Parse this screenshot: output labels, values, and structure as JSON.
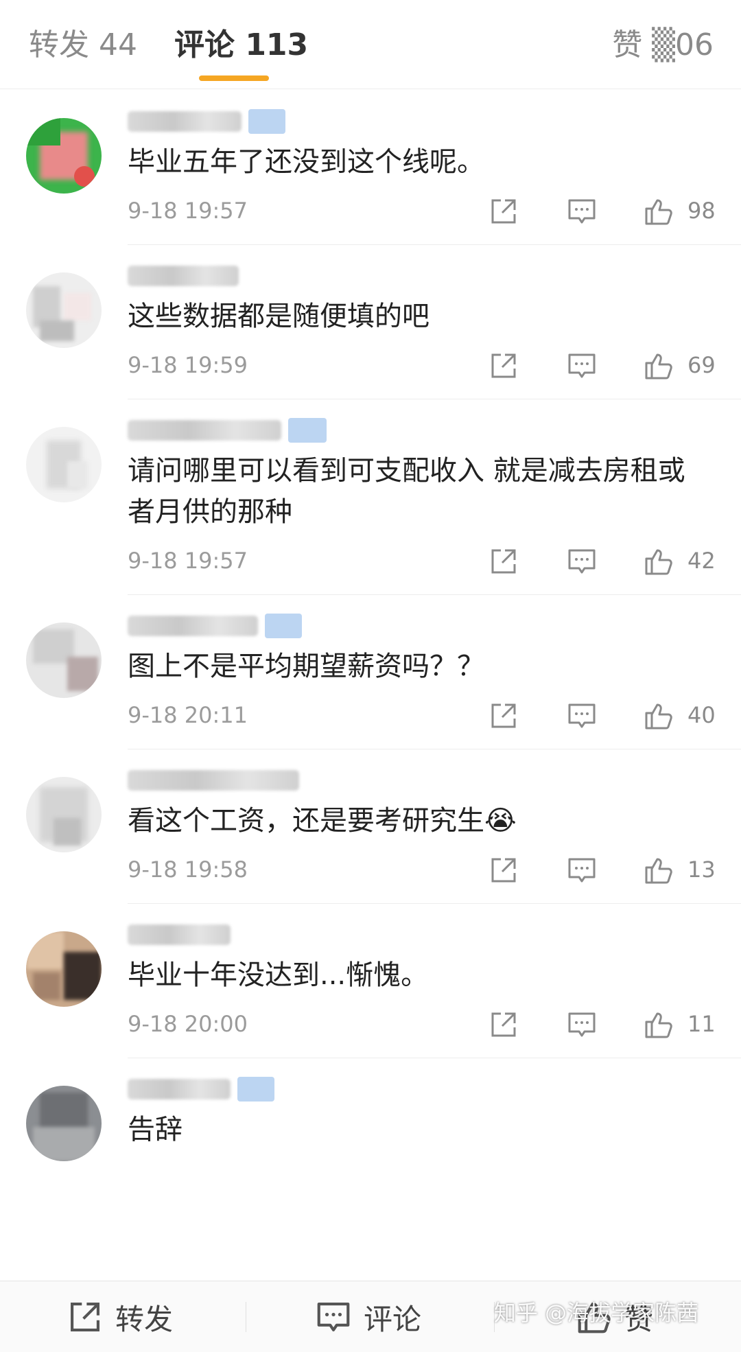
{
  "tabs": {
    "repost": "转发 44",
    "comment": "评论 113",
    "like": "赞 ▒06"
  },
  "comments": [
    {
      "text": "毕业五年了还没到这个线呢。",
      "time": "9-18 19:57",
      "likes": "98"
    },
    {
      "text": "这些数据都是随便填的吧",
      "time": "9-18 19:59",
      "likes": "69"
    },
    {
      "text": "请问哪里可以看到可支配收入 就是减去房租或者月供的那种",
      "time": "9-18 19:57",
      "likes": "42"
    },
    {
      "text": "图上不是平均期望薪资吗？？",
      "time": "9-18 20:11",
      "likes": "40"
    },
    {
      "text": "看这个工资，还是要考研究生😭",
      "time": "9-18 19:58",
      "likes": "13"
    },
    {
      "text": "毕业十年没达到...惭愧。",
      "time": "9-18 20:00",
      "likes": "11"
    },
    {
      "text": "告辞",
      "time": "",
      "likes": ""
    }
  ],
  "bottom_bar": {
    "repost": "转发",
    "comment": "评论",
    "like": "赞"
  },
  "watermark": "知乎 @海拔学家陈茜",
  "colors": {
    "accent": "#f5a623",
    "badge": "#bcd5f2"
  }
}
